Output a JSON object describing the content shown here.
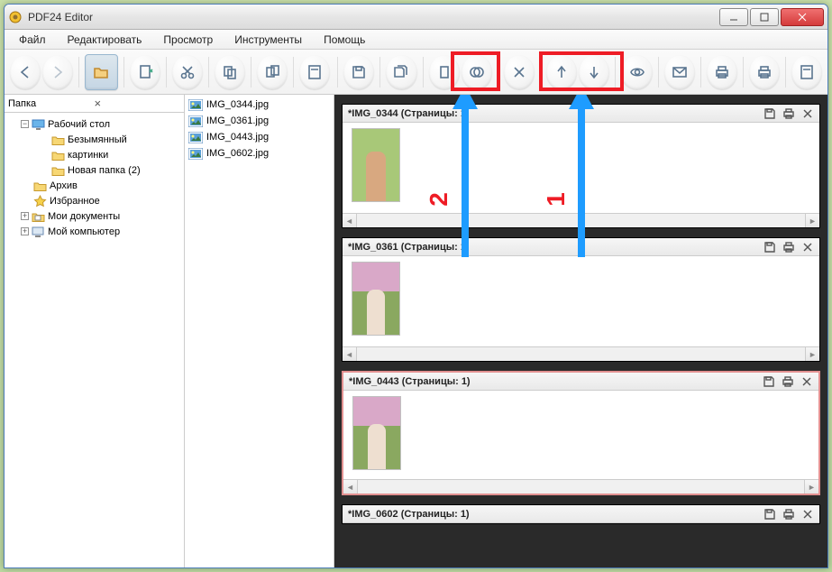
{
  "window": {
    "title": "PDF24 Editor"
  },
  "menu": [
    "Файл",
    "Редактировать",
    "Просмотр",
    "Инструменты",
    "Помощь"
  ],
  "sidebar": {
    "header": "Папка",
    "tree": [
      {
        "label": "Рабочий стол",
        "icon": "desktop",
        "exp": "-",
        "indent": 1
      },
      {
        "label": "Безымянный",
        "icon": "folder",
        "exp": "",
        "indent": 2
      },
      {
        "label": "картинки",
        "icon": "folder",
        "exp": "",
        "indent": 2
      },
      {
        "label": "Новая папка (2)",
        "icon": "folder",
        "exp": "",
        "indent": 2
      },
      {
        "label": "Архив",
        "icon": "folder",
        "exp": "",
        "indent": 1
      },
      {
        "label": "Избранное",
        "icon": "favorites",
        "exp": "",
        "indent": 1
      },
      {
        "label": "Мои документы",
        "icon": "docs",
        "exp": "+",
        "indent": 1
      },
      {
        "label": "Мой компьютер",
        "icon": "computer",
        "exp": "+",
        "indent": 1
      }
    ]
  },
  "files": [
    "IMG_0344.jpg",
    "IMG_0361.jpg",
    "IMG_0443.jpg",
    "IMG_0602.jpg"
  ],
  "documents": [
    {
      "title": "*IMG_0344 (Страницы: 1)",
      "thumb": "green"
    },
    {
      "title": "*IMG_0361 (Страницы: 1)",
      "thumb": "pink"
    },
    {
      "title": "*IMG_0443 (Страницы: 1)",
      "thumb": "pink",
      "selected": true
    },
    {
      "title": "*IMG_0602 (Страницы: 1)",
      "thumb": "green"
    }
  ],
  "annotations": {
    "label1": "1",
    "label2": "2"
  }
}
